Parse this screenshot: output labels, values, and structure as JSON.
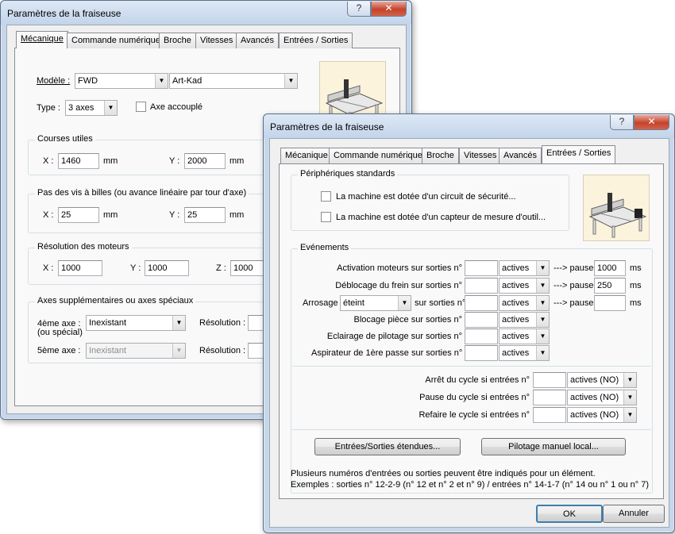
{
  "back_window": {
    "title": "Paramètres de la fraiseuse",
    "help_label": "?",
    "close_label": "✕",
    "tabs": [
      "Mécanique",
      "Commande numérique",
      "Broche",
      "Vitesses",
      "Avancés",
      "Entrées / Sorties"
    ],
    "model": {
      "label": "Modèle :",
      "value1": "FWD",
      "value2": "Art-Kad"
    },
    "type": {
      "label": "Type :",
      "value": "3 axes",
      "coupled_label": "Axe accouplé"
    },
    "courses": {
      "title": "Courses utiles",
      "x_label": "X :",
      "x_value": "1460",
      "x_unit": "mm",
      "y_label": "Y :",
      "y_value": "2000",
      "y_unit": "mm"
    },
    "pas": {
      "title": "Pas des vis à billes  (ou avance linéaire par tour d'axe)",
      "x_label": "X :",
      "x_value": "25",
      "x_unit": "mm",
      "y_label": "Y :",
      "y_value": "25",
      "y_unit": "mm"
    },
    "resolution": {
      "title": "Résolution des moteurs",
      "x_label": "X :",
      "x_value": "1000",
      "y_label": "Y :",
      "y_value": "1000",
      "z_label": "Z :",
      "z_value": "1000"
    },
    "axes": {
      "title": "Axes supplémentaires ou axes spéciaux",
      "axis4_label": "4ème axe :",
      "axis4_sub": "(ou spécial)",
      "axis4_value": "Inexistant",
      "res4_label": "Résolution :",
      "axis5_label": "5ème axe :",
      "axis5_value": "Inexistant",
      "res5_label": "Résolution :"
    }
  },
  "front_window": {
    "title": "Paramètres de la fraiseuse",
    "help_label": "?",
    "close_label": "✕",
    "tabs": [
      "Mécanique",
      "Commande numérique",
      "Broche",
      "Vitesses",
      "Avancés",
      "Entrées / Sorties"
    ],
    "peripheriques": {
      "title": "Périphériques standards",
      "security_label": "La machine est dotée d'un circuit de sécurité...",
      "sensor_label": "La machine est dotée d'un capteur de mesure d'outil..."
    },
    "evenements": {
      "title": "Evénements",
      "rows": [
        {
          "label": "Activation moteurs sur sorties n°",
          "state": "actives",
          "pause_label": "---> pause",
          "pause_value": "1000",
          "unit": "ms"
        },
        {
          "label": "Déblocage du frein sur sorties n°",
          "state": "actives",
          "pause_label": "---> pause",
          "pause_value": "250",
          "unit": "ms"
        },
        {
          "label": "sur sorties n°",
          "state": "actives",
          "pause_label": "---> pause",
          "pause_value": "",
          "unit": "ms"
        },
        {
          "label": "Blocage pièce sur sorties n°",
          "state": "actives"
        },
        {
          "label": "Eclairage de pilotage sur sorties n°",
          "state": "actives"
        },
        {
          "label": "Aspirateur de 1ère passe sur sorties n°",
          "state": "actives"
        }
      ],
      "arrosage_label": "Arrosage",
      "arrosage_value": "éteint",
      "cycle_rows": [
        {
          "label": "Arrêt du cycle si entrées n°",
          "state": "actives (NO)"
        },
        {
          "label": "Pause du cycle si entrées n°",
          "state": "actives (NO)"
        },
        {
          "label": "Refaire le cycle si entrées n°",
          "state": "actives (NO)"
        }
      ],
      "btn_extended": "Entrées/Sorties étendues...",
      "btn_manual": "Pilotage manuel local..."
    },
    "note_line1": "Plusieurs numéros d'entrées ou sorties peuvent être indiqués pour un élément.",
    "note_line2": "Exemples : sorties n° 12-2-9  (n° 12 et n° 2 et n° 9)   /   entrées n° 14-1-7  (n° 14 ou n° 1 ou n° 7)",
    "ok_label": "OK",
    "cancel_label": "Annuler"
  }
}
